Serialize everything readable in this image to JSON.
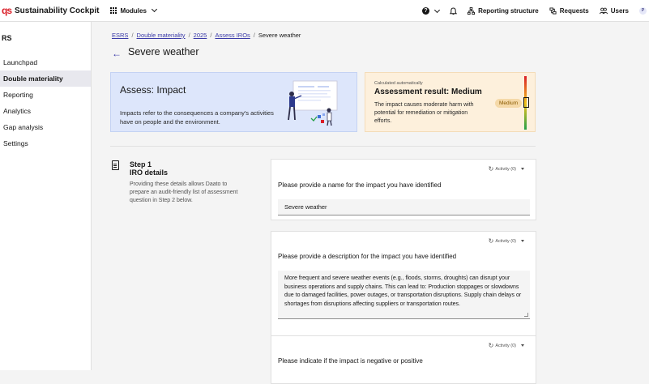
{
  "topbar": {
    "logo_mark": "qs",
    "app_title": "Sustainability Cockpit",
    "modules_label": "Modules",
    "help_icon": "?",
    "reporting_structure_label": "Reporting structure",
    "requests_label": "Requests",
    "users_label": "Users",
    "avatar_initial": "P"
  },
  "sidebar": {
    "heading": "RS",
    "items": [
      {
        "label": "Launchpad"
      },
      {
        "label": "Double materiality"
      },
      {
        "label": "Reporting"
      },
      {
        "label": "Analytics"
      },
      {
        "label": "Gap analysis"
      },
      {
        "label": "Settings"
      }
    ],
    "active_index": 1
  },
  "breadcrumb": {
    "items": [
      "ESRS",
      "Double materiality",
      "2025",
      "Assess IROs"
    ],
    "current": "Severe weather",
    "separator": "/"
  },
  "page": {
    "back_icon": "←",
    "title": "Severe weather"
  },
  "assess_card": {
    "title": "Assess: Impact",
    "text": "Impacts refer to the consequences a company's activities have on people and the environment."
  },
  "result_card": {
    "small_label": "Calculated automatically",
    "title": "Assessment result: Medium",
    "text": "The impact causes moderate harm with potential for remediation or mitigation efforts.",
    "badge": "Medium"
  },
  "step": {
    "number": "Step 1",
    "title": "IRO details",
    "description": "Providing these details allows Daato to prepare an audit-friendly list of assessment question in Step 2 below."
  },
  "questions": [
    {
      "activity": "Activity (0)",
      "label": "Please provide a name for the impact you have identified",
      "value": "Severe weather"
    },
    {
      "activity": "Activity (0)",
      "label": "Please provide a description for the impact you have identified",
      "value": "More frequent and severe weather events (e.g., floods, storms, droughts) can disrupt your business operations and supply chains. This can lead to: Production stoppages or slowdowns due to damaged facilities, power outages, or transportation disruptions. Supply chain delays or shortages from disruptions affecting suppliers or transportation routes."
    },
    {
      "activity": "Activity (0)",
      "label": "Please indicate if the impact is negative or positive"
    }
  ],
  "colors": {
    "accent": "#3a3aa8",
    "impact_bg": "#dde6fb",
    "result_bg": "#fdf0dc",
    "brand_red": "#da1e28"
  }
}
